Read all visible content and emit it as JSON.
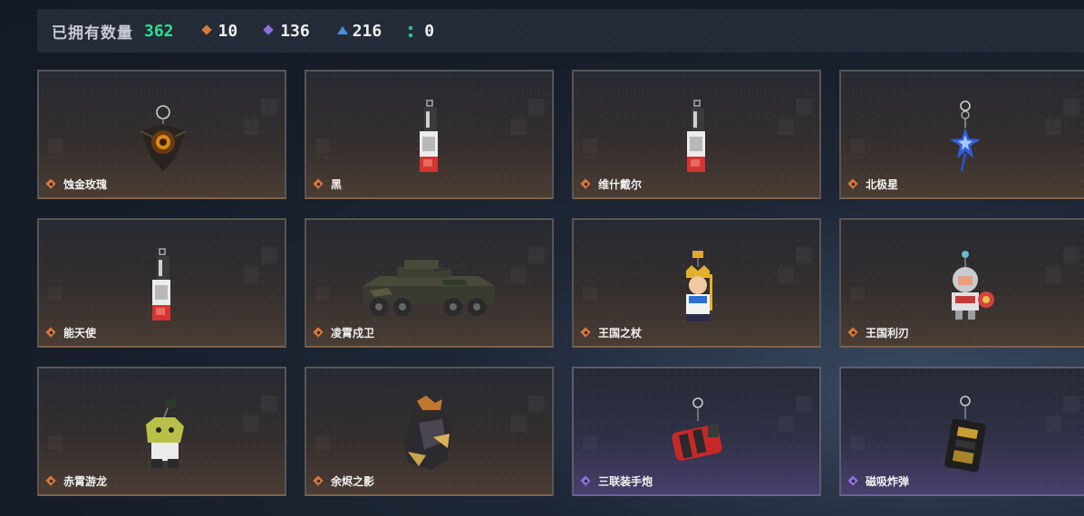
{
  "header": {
    "title": "已拥有数量",
    "total": "362",
    "stats": [
      {
        "icon": "orange-diamond-icon",
        "value": "10",
        "color": "#d9793a"
      },
      {
        "icon": "purple-diamond-icon",
        "value": "136",
        "color": "#8f6ee0"
      },
      {
        "icon": "blue-triangle-icon",
        "value": "216",
        "color": "#4a8ed8"
      },
      {
        "icon": "green-dots-icon",
        "value": "0",
        "color": "#2fc48b"
      }
    ]
  },
  "items": [
    {
      "name": "蚀金玫瑰",
      "rarity": "orange",
      "art": "rose-charm"
    },
    {
      "name": "黑",
      "rarity": "orange",
      "art": "lighter-charm"
    },
    {
      "name": "维什戴尔",
      "rarity": "orange",
      "art": "lighter-charm"
    },
    {
      "name": "北极星",
      "rarity": "orange",
      "art": "star-charm"
    },
    {
      "name": "能天使",
      "rarity": "orange",
      "art": "lighter-charm"
    },
    {
      "name": "凌霄戍卫",
      "rarity": "orange",
      "art": "armored-vehicle"
    },
    {
      "name": "王国之杖",
      "rarity": "orange",
      "art": "king-figure"
    },
    {
      "name": "王国利刃",
      "rarity": "orange",
      "art": "knight-figure"
    },
    {
      "name": "赤霄游龙",
      "rarity": "orange",
      "art": "dragon-figure"
    },
    {
      "name": "余烬之影",
      "rarity": "orange",
      "art": "shadow-figure"
    },
    {
      "name": "三联装手炮",
      "rarity": "purple",
      "art": "grenade-charm"
    },
    {
      "name": "磁吸炸弹",
      "rarity": "purple",
      "art": "bomb-charm"
    }
  ]
}
